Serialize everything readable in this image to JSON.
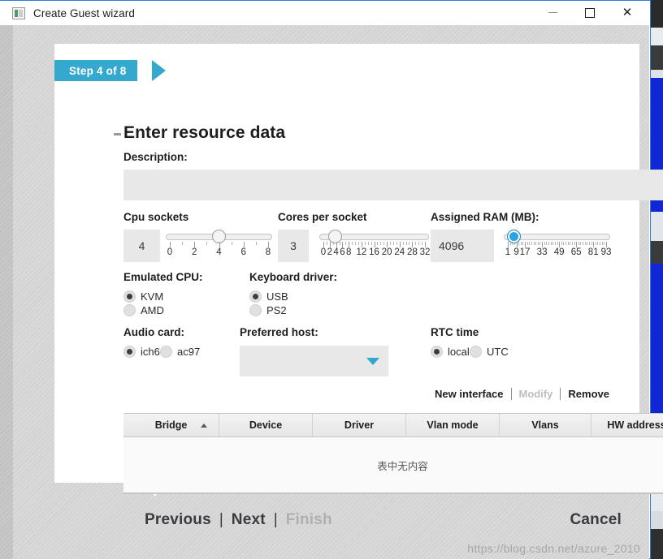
{
  "window": {
    "title": "Create Guest wizard",
    "icon": "app-window-icon",
    "minimize_label": "—",
    "maximize_label": "□",
    "close_label": "✕"
  },
  "wizard": {
    "step_badge": "Step 4 of 8",
    "page_title": "Enter resource data",
    "description": {
      "label": "Description:",
      "value": "",
      "placeholder": ""
    },
    "cpu_sockets": {
      "label": "Cpu sockets",
      "value": "4",
      "min": 0,
      "max": 8,
      "current": 4,
      "tick_labels": [
        "0",
        "2",
        "4",
        "6",
        "8"
      ],
      "tick_values": [
        0,
        2,
        4,
        6,
        8
      ]
    },
    "cores_per_socket": {
      "label": "Cores per socket",
      "value": "3",
      "min": 0,
      "max": 32,
      "current": 3,
      "tick_labels": [
        "0",
        "2",
        "4",
        "6",
        "8",
        "12",
        "16",
        "20",
        "24",
        "28",
        "32"
      ],
      "tick_values": [
        0,
        2,
        4,
        6,
        8,
        12,
        16,
        20,
        24,
        28,
        32
      ]
    },
    "assigned_ram": {
      "label": "Assigned RAM (MB):",
      "value": "4096",
      "min": 1,
      "max": 93,
      "current": 4,
      "tick_labels": [
        "1",
        "9",
        "17",
        "33",
        "49",
        "65",
        "81",
        "93"
      ],
      "tick_values": [
        1,
        9,
        17,
        33,
        49,
        65,
        81,
        93
      ]
    },
    "emulated_cpu": {
      "label": "Emulated CPU:",
      "options": [
        {
          "label": "KVM",
          "checked": true
        },
        {
          "label": "AMD",
          "checked": false
        }
      ]
    },
    "keyboard_driver": {
      "label": "Keyboard driver:",
      "options": [
        {
          "label": "USB",
          "checked": true
        },
        {
          "label": "PS2",
          "checked": false
        }
      ]
    },
    "audio_card": {
      "label": "Audio card:",
      "options": [
        {
          "label": "ich6",
          "checked": true
        },
        {
          "label": "ac97",
          "checked": false
        }
      ]
    },
    "preferred_host": {
      "label": "Preferred host:",
      "value": "",
      "arrow_icon": "chevron-down-icon"
    },
    "rtc_time": {
      "label": "RTC time",
      "options": [
        {
          "label": "local",
          "checked": true
        },
        {
          "label": "UTC",
          "checked": false
        }
      ]
    },
    "interfaces": {
      "actions": [
        {
          "label": "New interface",
          "disabled": false
        },
        {
          "label": "Modify",
          "disabled": true
        },
        {
          "label": "Remove",
          "disabled": false
        }
      ],
      "columns": [
        {
          "label": "Bridge",
          "sorted": true,
          "sort_dir": "asc"
        },
        {
          "label": "Device",
          "sorted": false
        },
        {
          "label": "Driver",
          "sorted": false
        },
        {
          "label": "Vlan mode",
          "sorted": false
        },
        {
          "label": "Vlans",
          "sorted": false
        },
        {
          "label": "HW address",
          "sorted": false
        }
      ],
      "rows": [],
      "empty_text": "表中无内容"
    },
    "nav": {
      "previous": "Previous",
      "next": "Next",
      "finish": "Finish",
      "finish_disabled": true,
      "cancel": "Cancel",
      "separator": "|"
    }
  },
  "watermark": "https://blog.csdn.net/azure_2010",
  "colors": {
    "accent_step": "#35a9cd",
    "accent_slider": "#2aa3e0",
    "window_border": "#2a7fd4",
    "bg_blue": "#1226d6",
    "field_bg": "#e8e8e8"
  }
}
